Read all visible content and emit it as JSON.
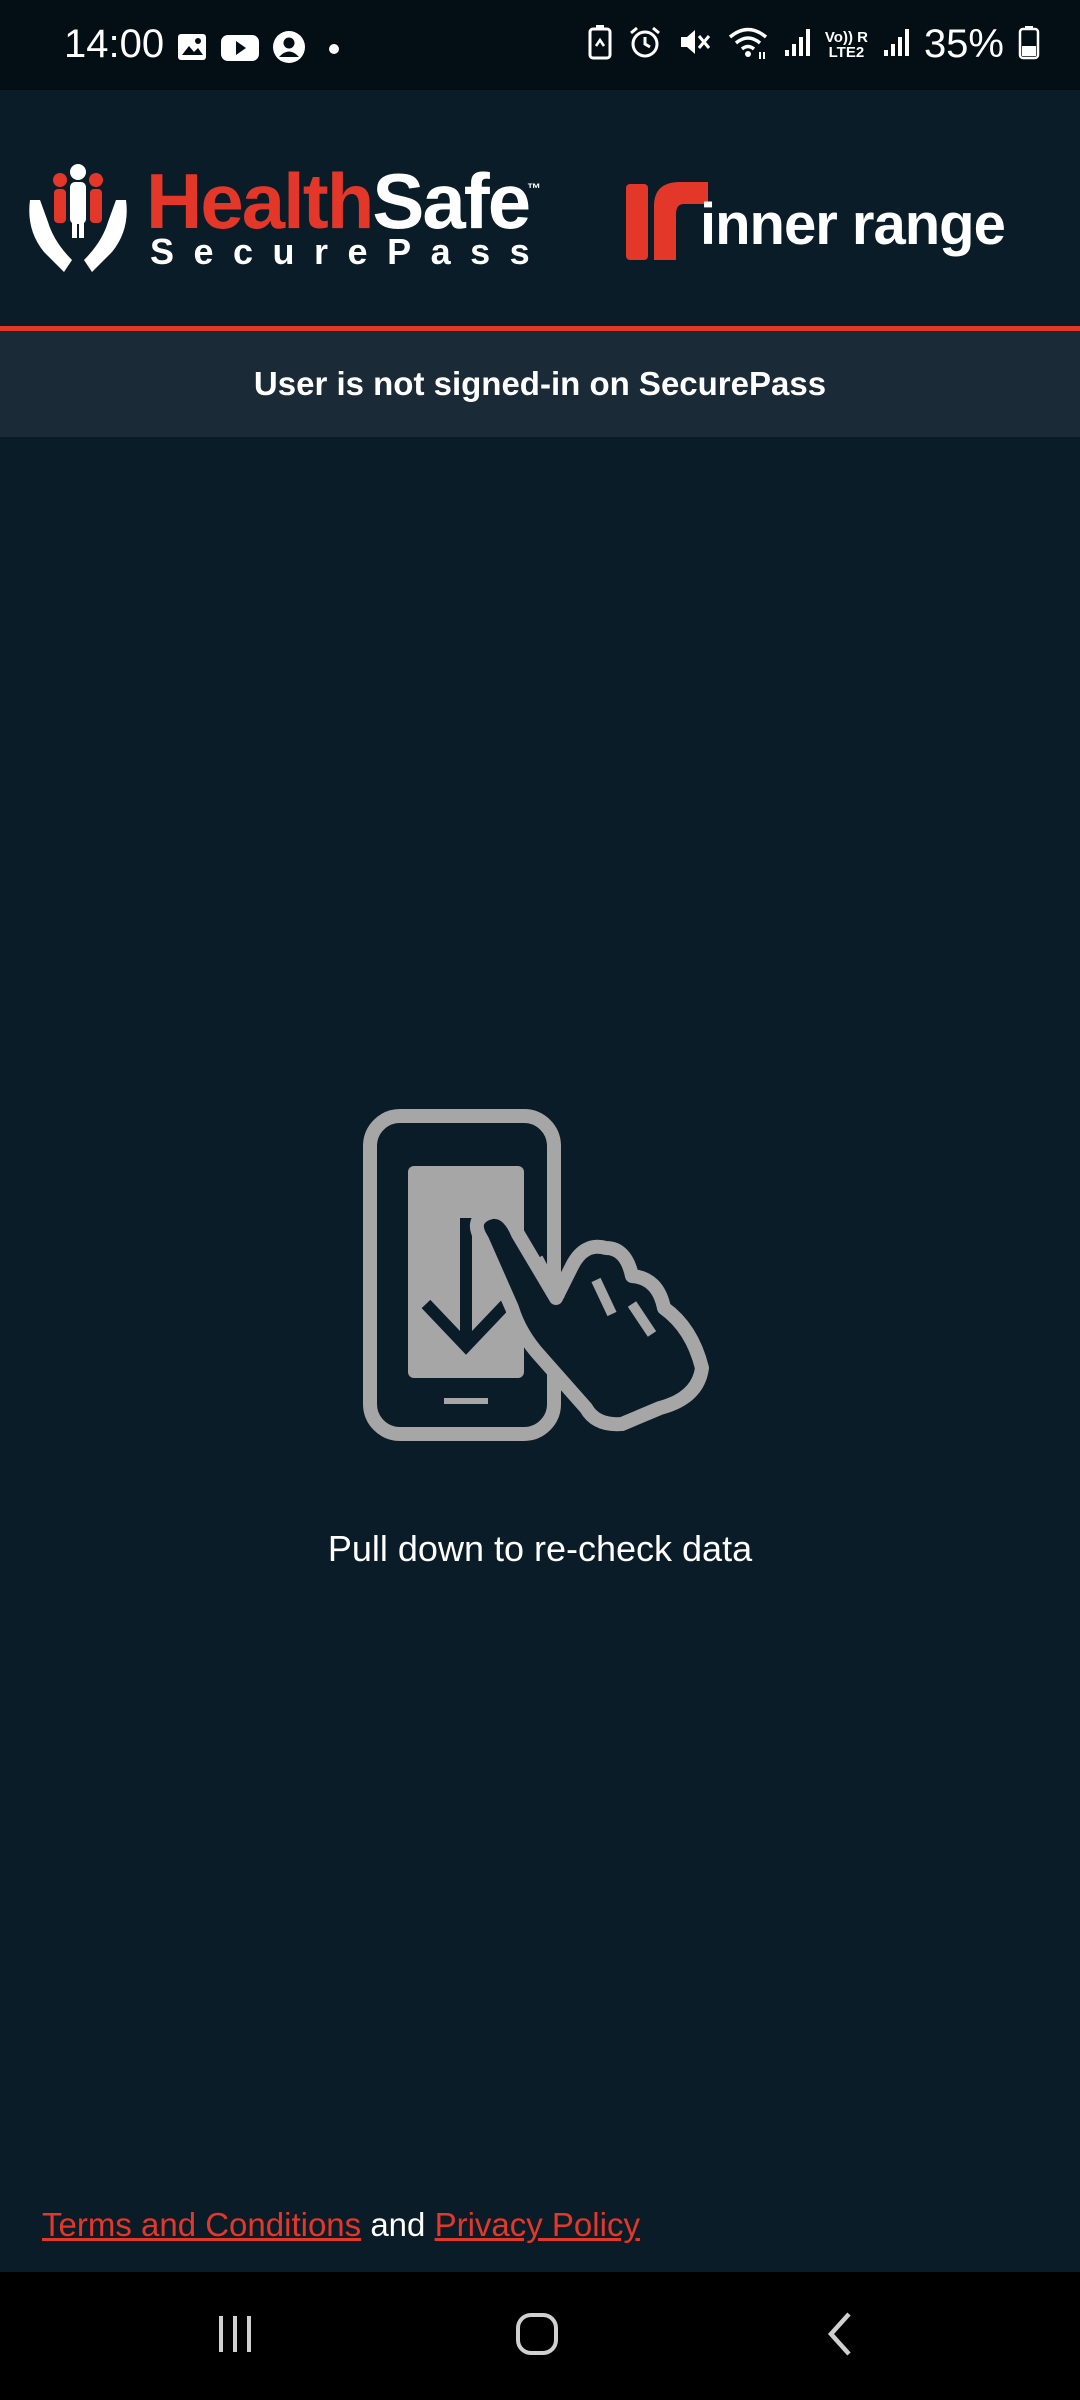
{
  "status_bar": {
    "time": "14:00",
    "battery_percent": "35%",
    "network_label_top": "Vo)) R",
    "network_label_bottom": "LTE2",
    "left_icons": [
      "gallery-icon",
      "youtube-icon",
      "account-icon",
      "dot-icon"
    ],
    "right_icons": [
      "battery-saver-icon",
      "alarm-icon",
      "mute-icon",
      "wifi-icon",
      "signal-icon",
      "signal-icon-2",
      "battery-icon"
    ]
  },
  "header": {
    "brand_health": "Health",
    "brand_safe": "Safe",
    "brand_tm": "™",
    "brand_sub": "SecurePass",
    "partner_name": "inner range"
  },
  "notice": {
    "text": "User is not signed-in on SecurePass"
  },
  "main": {
    "illustration": "pull-down-phone-icon",
    "pull_text": "Pull down to re-check data"
  },
  "footer": {
    "terms_label": "Terms and Conditions",
    "and_label": "and",
    "privacy_label": "Privacy Policy"
  },
  "navbar": {
    "buttons": [
      "recent-apps-icon",
      "home-icon",
      "back-icon"
    ]
  },
  "colors": {
    "background": "#0a1c28",
    "accent": "#e3372a",
    "notice_bg": "#1a2a36"
  }
}
